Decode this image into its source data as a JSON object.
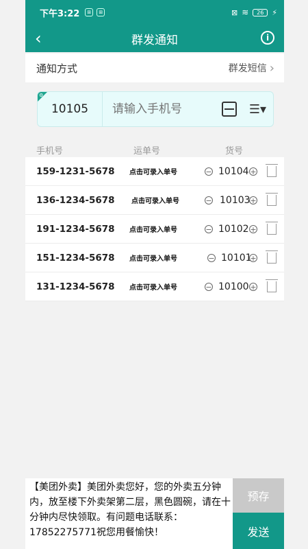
{
  "status_bar": {
    "time": "下午3:22",
    "battery": "26"
  },
  "nav": {
    "title": "群发通知"
  },
  "notify_method": {
    "label": "通知方式",
    "value": "群发短信"
  },
  "input": {
    "current_no": "10105",
    "placeholder": "请输入手机号"
  },
  "columns": [
    "手机号",
    "运单号",
    "货号"
  ],
  "rows": [
    {
      "phone": "159-1231-5678",
      "track": "点击可录入单号",
      "goods": "10104"
    },
    {
      "phone": "136-1234-5678",
      "track": "点击可录入单号",
      "goods": "10103"
    },
    {
      "phone": "191-1234-5678",
      "track": "点击可录入单号",
      "goods": "10102"
    },
    {
      "phone": "151-1234-5678",
      "track": "点击可录入单号",
      "goods": "10101"
    },
    {
      "phone": "131-1234-5678",
      "track": "点击可录入单号",
      "goods": "10100"
    }
  ],
  "message": "【美团外卖】美团外卖您好，您的外卖五分钟内，放至楼下外卖架第二层，黑色圆碗，请在十分钟内尽快领取。有问题电话联系：17852275771祝您用餐愉快！",
  "buttons": {
    "save": "预存",
    "send": "发送"
  },
  "colors": {
    "primary": "#129889"
  }
}
